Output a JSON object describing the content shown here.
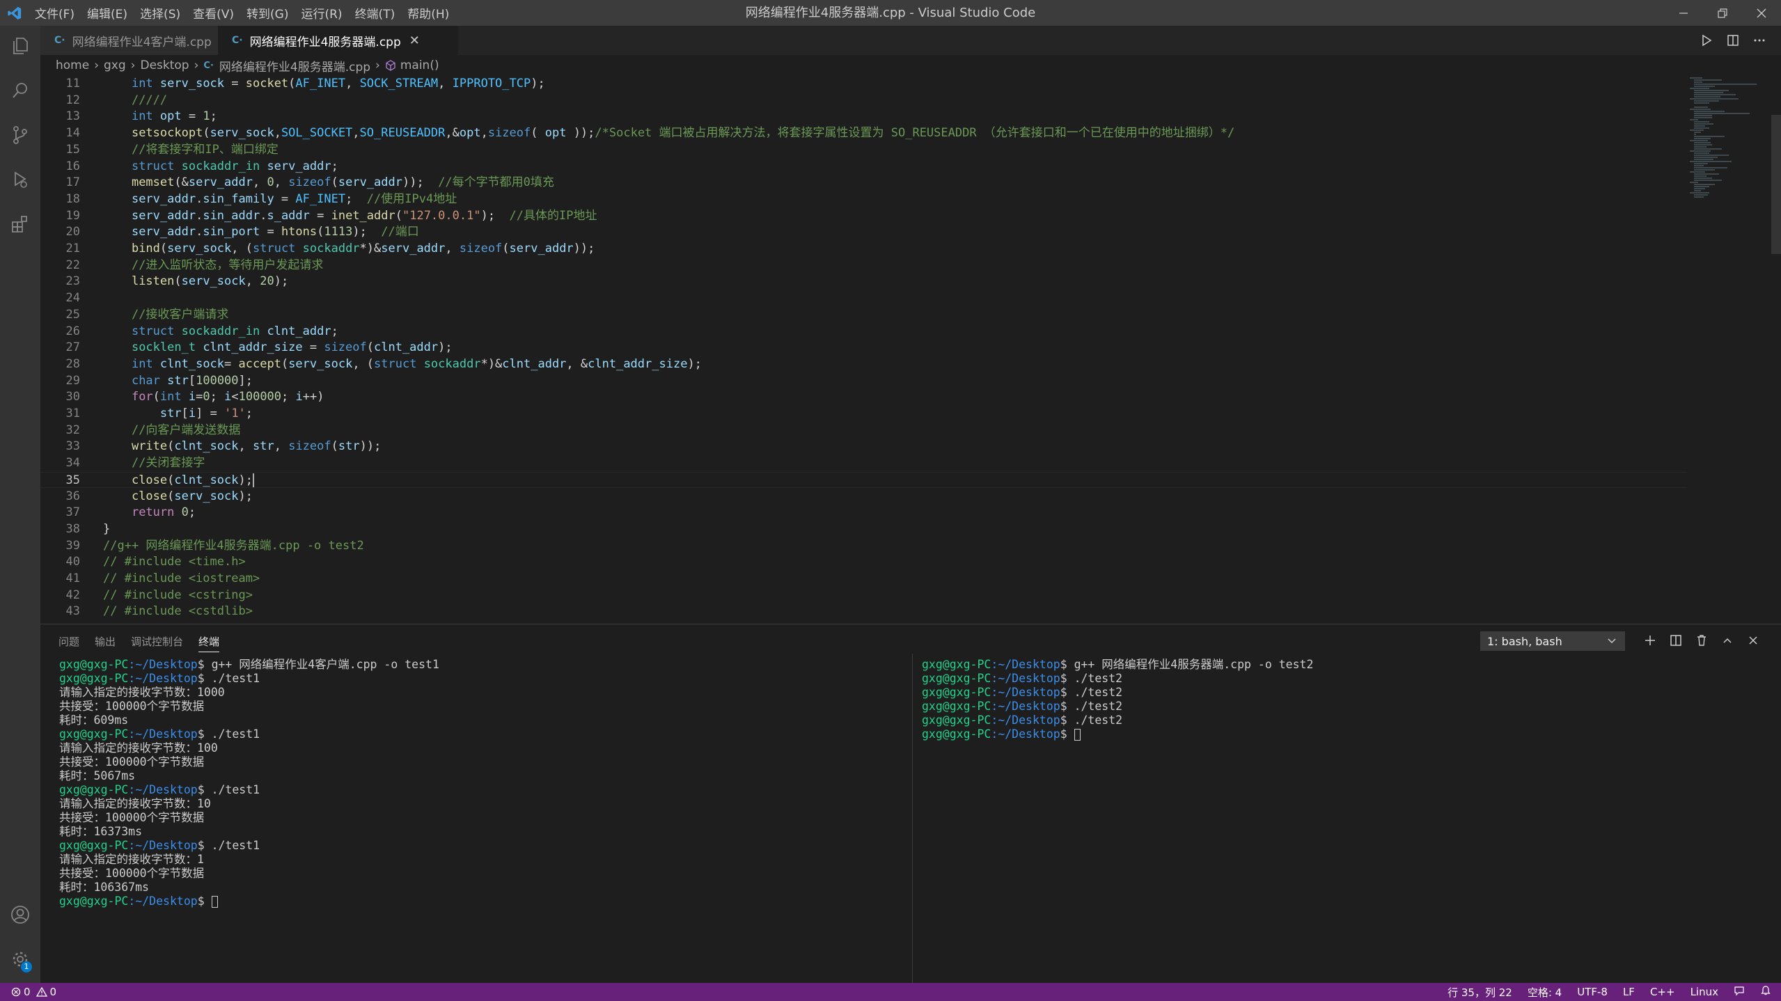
{
  "window": {
    "title": "网络编程作业4服务器端.cpp - Visual Studio Code",
    "menu": [
      "文件(F)",
      "编辑(E)",
      "选择(S)",
      "查看(V)",
      "转到(G)",
      "运行(R)",
      "终端(T)",
      "帮助(H)"
    ]
  },
  "tabs": [
    {
      "label": "网络编程作业4客户端.cpp",
      "active": false
    },
    {
      "label": "网络编程作业4服务器端.cpp",
      "active": true
    }
  ],
  "breadcrumb": [
    "home",
    "gxg",
    "Desktop",
    "网络编程作业4服务器端.cpp",
    "main()"
  ],
  "editor": {
    "current_line": 35,
    "lines": [
      {
        "n": "11",
        "t": [
          [
            "kw",
            "int "
          ],
          [
            "var",
            "serv_sock"
          ],
          [
            "pl",
            " = "
          ],
          [
            "fn",
            "socket"
          ],
          [
            "pl",
            "("
          ],
          [
            "mac",
            "AF_INET"
          ],
          [
            "pl",
            ", "
          ],
          [
            "mac",
            "SOCK_STREAM"
          ],
          [
            "pl",
            ", "
          ],
          [
            "mac",
            "IPPROTO_TCP"
          ],
          [
            "pl",
            ");"
          ]
        ]
      },
      {
        "n": "12",
        "t": [
          [
            "cm",
            "/////"
          ]
        ]
      },
      {
        "n": "13",
        "t": [
          [
            "kw",
            "int "
          ],
          [
            "var",
            "opt"
          ],
          [
            "pl",
            " = "
          ],
          [
            "num",
            "1"
          ],
          [
            "pl",
            ";"
          ]
        ]
      },
      {
        "n": "14",
        "t": [
          [
            "fn",
            "setsockopt"
          ],
          [
            "pl",
            "("
          ],
          [
            "var",
            "serv_sock"
          ],
          [
            "pl",
            ","
          ],
          [
            "mac",
            "SOL_SOCKET"
          ],
          [
            "pl",
            ","
          ],
          [
            "mac",
            "SO_REUSEADDR"
          ],
          [
            "pl",
            ",&"
          ],
          [
            "var",
            "opt"
          ],
          [
            "pl",
            ","
          ],
          [
            "kw",
            "sizeof"
          ],
          [
            "pl",
            "( "
          ],
          [
            "var",
            "opt"
          ],
          [
            "pl",
            " ));"
          ],
          [
            "cm",
            "/*Socket 端口被占用解决方法，将套接字属性设置为 SO_REUSEADDR （允许套接口和一个已在使用中的地址捆绑）*/"
          ]
        ]
      },
      {
        "n": "15",
        "t": [
          [
            "cm",
            "//将套接字和IP、端口绑定"
          ]
        ]
      },
      {
        "n": "16",
        "t": [
          [
            "kw",
            "struct "
          ],
          [
            "tp",
            "sockaddr_in "
          ],
          [
            "var",
            "serv_addr"
          ],
          [
            "pl",
            ";"
          ]
        ]
      },
      {
        "n": "17",
        "t": [
          [
            "fn",
            "memset"
          ],
          [
            "pl",
            "(&"
          ],
          [
            "var",
            "serv_addr"
          ],
          [
            "pl",
            ", "
          ],
          [
            "num",
            "0"
          ],
          [
            "pl",
            ", "
          ],
          [
            "kw",
            "sizeof"
          ],
          [
            "pl",
            "("
          ],
          [
            "var",
            "serv_addr"
          ],
          [
            "pl",
            "));  "
          ],
          [
            "cm",
            "//每个字节都用0填充"
          ]
        ]
      },
      {
        "n": "18",
        "t": [
          [
            "var",
            "serv_addr"
          ],
          [
            "pl",
            "."
          ],
          [
            "var",
            "sin_family"
          ],
          [
            "pl",
            " = "
          ],
          [
            "mac",
            "AF_INET"
          ],
          [
            "pl",
            ";  "
          ],
          [
            "cm",
            "//使用IPv4地址"
          ]
        ]
      },
      {
        "n": "19",
        "t": [
          [
            "var",
            "serv_addr"
          ],
          [
            "pl",
            "."
          ],
          [
            "var",
            "sin_addr"
          ],
          [
            "pl",
            "."
          ],
          [
            "var",
            "s_addr"
          ],
          [
            "pl",
            " = "
          ],
          [
            "fn",
            "inet_addr"
          ],
          [
            "pl",
            "("
          ],
          [
            "str",
            "\"127.0.0.1\""
          ],
          [
            "pl",
            ");  "
          ],
          [
            "cm",
            "//具体的IP地址"
          ]
        ]
      },
      {
        "n": "20",
        "t": [
          [
            "var",
            "serv_addr"
          ],
          [
            "pl",
            "."
          ],
          [
            "var",
            "sin_port"
          ],
          [
            "pl",
            " = "
          ],
          [
            "fn",
            "htons"
          ],
          [
            "pl",
            "("
          ],
          [
            "num",
            "1113"
          ],
          [
            "pl",
            ");  "
          ],
          [
            "cm",
            "//端口"
          ]
        ]
      },
      {
        "n": "21",
        "t": [
          [
            "fn",
            "bind"
          ],
          [
            "pl",
            "("
          ],
          [
            "var",
            "serv_sock"
          ],
          [
            "pl",
            ", ("
          ],
          [
            "kw",
            "struct "
          ],
          [
            "tp",
            "sockaddr"
          ],
          [
            "pl",
            "*)&"
          ],
          [
            "var",
            "serv_addr"
          ],
          [
            "pl",
            ", "
          ],
          [
            "kw",
            "sizeof"
          ],
          [
            "pl",
            "("
          ],
          [
            "var",
            "serv_addr"
          ],
          [
            "pl",
            "));"
          ]
        ]
      },
      {
        "n": "22",
        "t": [
          [
            "cm",
            "//进入监听状态，等待用户发起请求"
          ]
        ]
      },
      {
        "n": "23",
        "t": [
          [
            "fn",
            "listen"
          ],
          [
            "pl",
            "("
          ],
          [
            "var",
            "serv_sock"
          ],
          [
            "pl",
            ", "
          ],
          [
            "num",
            "20"
          ],
          [
            "pl",
            ");"
          ]
        ]
      },
      {
        "n": "24",
        "t": []
      },
      {
        "n": "25",
        "t": [
          [
            "cm",
            "//接收客户端请求"
          ]
        ]
      },
      {
        "n": "26",
        "t": [
          [
            "kw",
            "struct "
          ],
          [
            "tp",
            "sockaddr_in "
          ],
          [
            "var",
            "clnt_addr"
          ],
          [
            "pl",
            ";"
          ]
        ]
      },
      {
        "n": "27",
        "t": [
          [
            "tp",
            "socklen_t "
          ],
          [
            "var",
            "clnt_addr_size"
          ],
          [
            "pl",
            " = "
          ],
          [
            "kw",
            "sizeof"
          ],
          [
            "pl",
            "("
          ],
          [
            "var",
            "clnt_addr"
          ],
          [
            "pl",
            ");"
          ]
        ]
      },
      {
        "n": "28",
        "t": [
          [
            "kw",
            "int "
          ],
          [
            "var",
            "clnt_sock"
          ],
          [
            "pl",
            "= "
          ],
          [
            "fn",
            "accept"
          ],
          [
            "pl",
            "("
          ],
          [
            "var",
            "serv_sock"
          ],
          [
            "pl",
            ", ("
          ],
          [
            "kw",
            "struct "
          ],
          [
            "tp",
            "sockaddr"
          ],
          [
            "pl",
            "*)&"
          ],
          [
            "var",
            "clnt_addr"
          ],
          [
            "pl",
            ", &"
          ],
          [
            "var",
            "clnt_addr_size"
          ],
          [
            "pl",
            ");"
          ]
        ]
      },
      {
        "n": "29",
        "t": [
          [
            "kw",
            "char "
          ],
          [
            "var",
            "str"
          ],
          [
            "pl",
            "["
          ],
          [
            "num",
            "100000"
          ],
          [
            "pl",
            "];"
          ]
        ]
      },
      {
        "n": "30",
        "t": [
          [
            "pp",
            "for"
          ],
          [
            "pl",
            "("
          ],
          [
            "kw",
            "int "
          ],
          [
            "var",
            "i"
          ],
          [
            "pl",
            "="
          ],
          [
            "num",
            "0"
          ],
          [
            "pl",
            "; "
          ],
          [
            "var",
            "i"
          ],
          [
            "pl",
            "<"
          ],
          [
            "num",
            "100000"
          ],
          [
            "pl",
            "; "
          ],
          [
            "var",
            "i"
          ],
          [
            "pl",
            "++)"
          ]
        ]
      },
      {
        "n": "31",
        "t": [
          [
            "pl",
            "    "
          ],
          [
            "var",
            "str"
          ],
          [
            "pl",
            "["
          ],
          [
            "var",
            "i"
          ],
          [
            "pl",
            "] = "
          ],
          [
            "str",
            "'1'"
          ],
          [
            "pl",
            ";"
          ]
        ]
      },
      {
        "n": "32",
        "t": [
          [
            "cm",
            "//向客户端发送数据"
          ]
        ]
      },
      {
        "n": "33",
        "t": [
          [
            "fn",
            "write"
          ],
          [
            "pl",
            "("
          ],
          [
            "var",
            "clnt_sock"
          ],
          [
            "pl",
            ", "
          ],
          [
            "var",
            "str"
          ],
          [
            "pl",
            ", "
          ],
          [
            "kw",
            "sizeof"
          ],
          [
            "pl",
            "("
          ],
          [
            "var",
            "str"
          ],
          [
            "pl",
            "));"
          ]
        ]
      },
      {
        "n": "34",
        "t": [
          [
            "cm",
            "//关闭套接字"
          ]
        ]
      },
      {
        "n": "35",
        "t": [
          [
            "fn",
            "close"
          ],
          [
            "pl",
            "("
          ],
          [
            "var",
            "clnt_sock"
          ],
          [
            "pl",
            ");"
          ]
        ]
      },
      {
        "n": "36",
        "t": [
          [
            "fn",
            "close"
          ],
          [
            "pl",
            "("
          ],
          [
            "var",
            "serv_sock"
          ],
          [
            "pl",
            ");"
          ]
        ]
      },
      {
        "n": "37",
        "t": [
          [
            "pp",
            "return "
          ],
          [
            "num",
            "0"
          ],
          [
            "pl",
            ";"
          ]
        ]
      },
      {
        "n": "38",
        "t": [
          [
            "pl",
            "}"
          ]
        ]
      },
      {
        "n": "39",
        "t": [
          [
            "cm",
            "//g++ 网络编程作业4服务器端.cpp -o test2"
          ]
        ]
      },
      {
        "n": "40",
        "t": [
          [
            "cm",
            "// #include <time.h>"
          ]
        ]
      },
      {
        "n": "41",
        "t": [
          [
            "cm",
            "// #include <iostream>"
          ]
        ]
      },
      {
        "n": "42",
        "t": [
          [
            "cm",
            "// #include <cstring>"
          ]
        ]
      },
      {
        "n": "43",
        "t": [
          [
            "cm",
            "// #include <cstdlib>"
          ]
        ]
      }
    ]
  },
  "panel": {
    "tabs": [
      "问题",
      "输出",
      "调试控制台",
      "终端"
    ],
    "active_tab": "终端",
    "terminal_select": "1: bash, bash",
    "prompt_user": "gxg@gxg-PC",
    "prompt_path": ":~/Desktop",
    "left_terminal": [
      {
        "cmd": "g++ 网络编程作业4客户端.cpp -o test1"
      },
      {
        "cmd": "./test1"
      },
      {
        "out": "请输入指定的接收字节数：1000"
      },
      {
        "out": "共接受：100000个字节数据"
      },
      {
        "out": "耗时：609ms"
      },
      {
        "cmd": "./test1"
      },
      {
        "out": "请输入指定的接收字节数：100"
      },
      {
        "out": "共接受：100000个字节数据"
      },
      {
        "out": "耗时：5067ms"
      },
      {
        "cmd": "./test1"
      },
      {
        "out": "请输入指定的接收字节数：10"
      },
      {
        "out": "共接受：100000个字节数据"
      },
      {
        "out": "耗时：16373ms"
      },
      {
        "cmd": "./test1"
      },
      {
        "out": "请输入指定的接收字节数：1"
      },
      {
        "out": "共接受：100000个字节数据"
      },
      {
        "out": "耗时：106367ms"
      },
      {
        "cmd": "",
        "cursor": true
      }
    ],
    "right_terminal": [
      {
        "cmd": "g++ 网络编程作业4服务器端.cpp -o test2"
      },
      {
        "cmd": "./test2"
      },
      {
        "cmd": "./test2"
      },
      {
        "cmd": "./test2"
      },
      {
        "cmd": "./test2"
      },
      {
        "cmd": "",
        "cursor": true
      }
    ]
  },
  "statusbar": {
    "errors": "0",
    "warnings": "0",
    "position": "行 35，列 22",
    "spaces": "空格: 4",
    "encoding": "UTF-8",
    "eol": "LF",
    "language": "C++",
    "os": "Linux",
    "settings_badge": "1"
  },
  "colors": {
    "statusbar": "#68217a",
    "titlebar": "#3c3c3c",
    "editor_bg": "#1e1e1e",
    "prompt_user": "#23d18b",
    "prompt_path": "#3b8eea"
  }
}
